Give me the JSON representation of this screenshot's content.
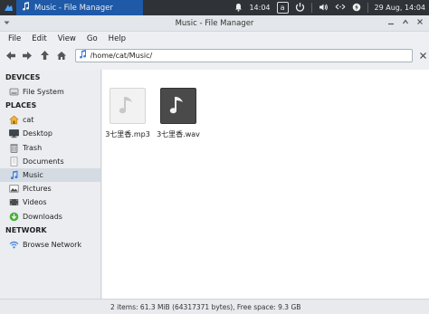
{
  "panel": {
    "task_title": "Music - File Manager",
    "clock_time": "14:04",
    "keyboard_layout": "a",
    "date_time": "29 Aug, 14:04"
  },
  "window": {
    "title": "Music - File Manager"
  },
  "menu": [
    "File",
    "Edit",
    "View",
    "Go",
    "Help"
  ],
  "location": {
    "path": "/home/cat/Music/"
  },
  "sidebar": {
    "devices_header": "DEVICES",
    "devices": [
      {
        "label": "File System",
        "icon": "drive-icon"
      }
    ],
    "places_header": "PLACES",
    "places": [
      {
        "label": "cat",
        "icon": "home-icon"
      },
      {
        "label": "Desktop",
        "icon": "desktop-icon"
      },
      {
        "label": "Trash",
        "icon": "trash-icon"
      },
      {
        "label": "Documents",
        "icon": "documents-icon"
      },
      {
        "label": "Music",
        "icon": "music-icon"
      },
      {
        "label": "Pictures",
        "icon": "pictures-icon"
      },
      {
        "label": "Videos",
        "icon": "videos-icon"
      },
      {
        "label": "Downloads",
        "icon": "downloads-icon"
      }
    ],
    "network_header": "NETWORK",
    "network": [
      {
        "label": "Browse Network",
        "icon": "network-icon"
      }
    ],
    "selected": "Music"
  },
  "files": [
    {
      "name": "3七里香.mp3",
      "icon": "audio-file-icon"
    },
    {
      "name": "3七里香.wav",
      "icon": "audio-file-dark-icon"
    }
  ],
  "status": {
    "text": "2 items: 61.3 MiB (64317371 bytes), Free space: 9.3 GB"
  },
  "colors": {
    "panel_bg": "#2f3237",
    "task_active": "#1e5aa8",
    "accent_blue": "#3b7dd8",
    "selection": "#d5dbe3"
  }
}
